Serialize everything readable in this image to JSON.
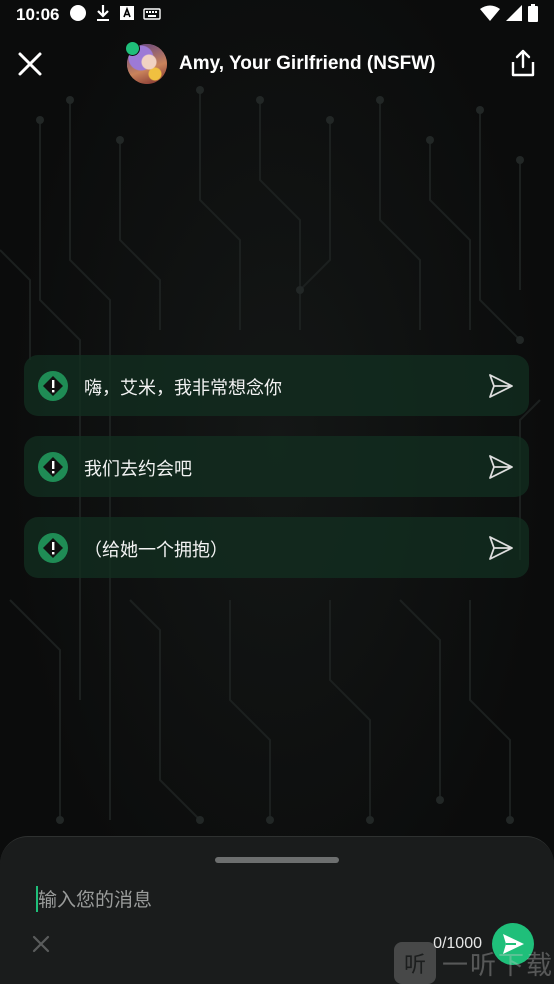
{
  "status_bar": {
    "time": "10:06",
    "left_icons": [
      "circle-icon",
      "download-icon",
      "a-box-icon",
      "keyboard-icon"
    ],
    "right_icons": [
      "wifi-icon",
      "signal-icon",
      "battery-icon"
    ]
  },
  "header": {
    "title": "Amy, Your Girlfriend (NSFW)",
    "online": true,
    "close_icon": "close-icon",
    "share_icon": "share-icon"
  },
  "suggestions": [
    {
      "text": "嗨，艾米，我非常想念你"
    },
    {
      "text": "我们去约会吧"
    },
    {
      "text": "（给她一个拥抱）"
    }
  ],
  "composer": {
    "placeholder": "输入您的消息",
    "value": "",
    "counter": "0/1000",
    "send_icon": "send-icon",
    "clear_icon": "close-icon"
  },
  "watermark": {
    "logo_char": "听",
    "text": "一听下载"
  },
  "colors": {
    "accent": "#1fbf7a",
    "suggestion_bg": "#122e20",
    "background": "#0b0c0c",
    "sheet_bg": "#1a1c1c"
  }
}
